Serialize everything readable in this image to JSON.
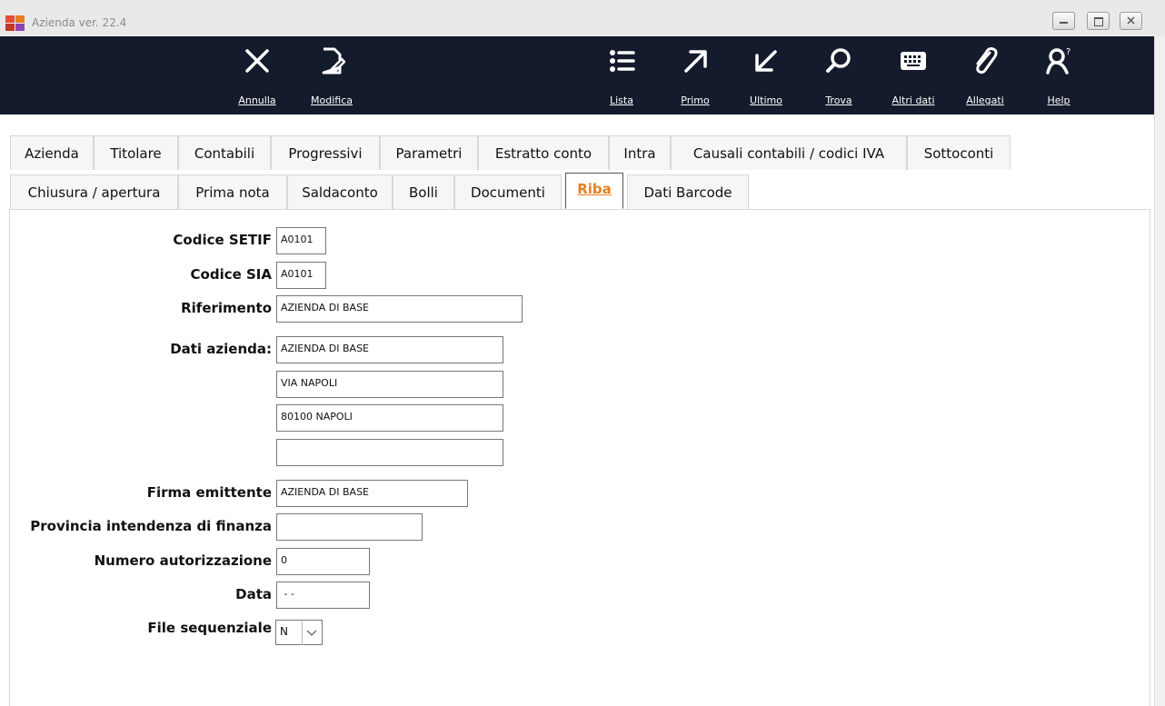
{
  "window": {
    "title": "Azienda ver. 22.4",
    "buttons": [
      "minimize",
      "maximize",
      "close"
    ]
  },
  "toolbar": {
    "items": [
      {
        "label": "Annulla",
        "icon": "close-icon"
      },
      {
        "label": "Modifica",
        "icon": "edit-icon"
      },
      {
        "label": "Lista",
        "icon": "list-icon"
      },
      {
        "label": "Primo",
        "icon": "arrow-up-right-icon"
      },
      {
        "label": "Ultimo",
        "icon": "arrow-down-left-icon"
      },
      {
        "label": "Trova",
        "icon": "search-icon"
      },
      {
        "label": "Altri dati",
        "icon": "keyboard-icon"
      },
      {
        "label": "Allegati",
        "icon": "paperclip-icon"
      },
      {
        "label": "Help",
        "icon": "help-person-icon"
      }
    ],
    "colors": {
      "background": "#141b2c",
      "foreground": "#ffffff"
    }
  },
  "tabs_row1": [
    "Azienda",
    "Titolare",
    "Contabili",
    "Progressivi",
    "Parametri",
    "Estratto conto",
    "Intra",
    "Causali contabili / codici IVA",
    "Sottoconti"
  ],
  "tabs_row2": [
    "Chiusura / apertura",
    "Prima nota",
    "Saldaconto",
    "Bolli",
    "Documenti",
    "Riba",
    "Dati Barcode"
  ],
  "active_tab": "Riba",
  "accent_color": "#e67e22",
  "form": {
    "codice_setif": {
      "label": "Codice SETIF",
      "value": "A0101"
    },
    "codice_sia": {
      "label": "Codice SIA",
      "value": "A0101"
    },
    "riferimento": {
      "label": "Riferimento",
      "value": "AZIENDA DI BASE"
    },
    "dati_azienda": {
      "label": "Dati azienda:",
      "lines": [
        "AZIENDA DI BASE",
        "VIA NAPOLI",
        "80100 NAPOLI",
        ""
      ]
    },
    "firma_emittente": {
      "label": "Firma emittente",
      "value": "AZIENDA DI BASE"
    },
    "provincia": {
      "label": "Provincia intendenza di finanza",
      "value": ""
    },
    "numero_autorizzazione": {
      "label": "Numero autorizzazione",
      "value": "0"
    },
    "data": {
      "label": "Data",
      "value": " - -"
    },
    "file_sequenziale": {
      "label": "File sequenziale",
      "value": "N"
    }
  }
}
